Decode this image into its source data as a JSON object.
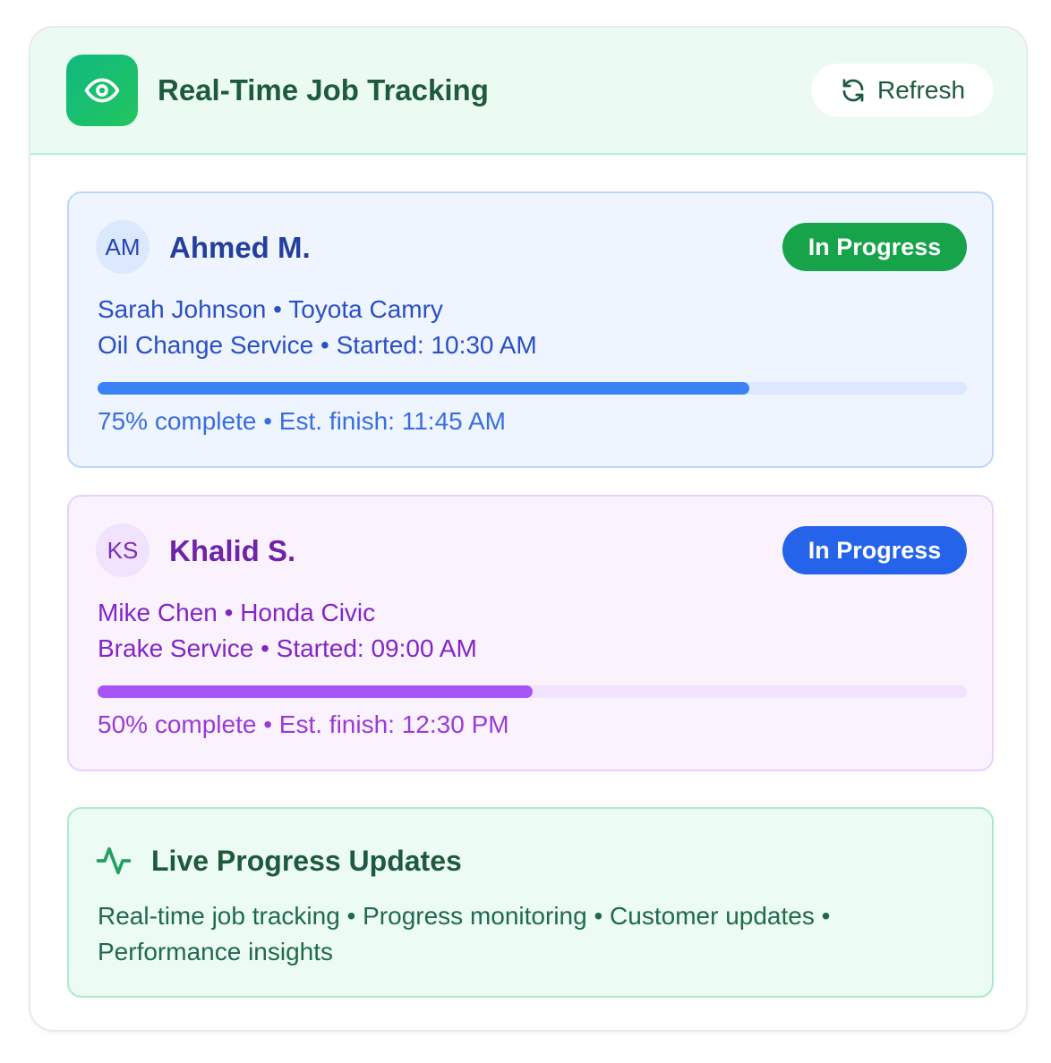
{
  "header": {
    "title": "Real-Time Job Tracking",
    "icon": "eye-icon",
    "refresh_label": "Refresh",
    "refresh_icon": "refresh-icon"
  },
  "jobs": [
    {
      "initials": "AM",
      "technician": "Ahmed M.",
      "status": "In Progress",
      "status_color": "#16a34a",
      "customer_vehicle": "Sarah Johnson • Toyota Camry",
      "service_started": "Oil Change Service • Started: 10:30 AM",
      "progress_percent": 75,
      "progress_text": "75% complete • Est. finish: 11:45 AM",
      "accent": "#3b82f6"
    },
    {
      "initials": "KS",
      "technician": "Khalid S.",
      "status": "In Progress",
      "status_color": "#2563eb",
      "customer_vehicle": "Mike Chen • Honda Civic",
      "service_started": "Brake Service • Started: 09:00 AM",
      "progress_percent": 50,
      "progress_text": "50% complete • Est. finish: 12:30 PM",
      "accent": "#a855f7"
    }
  ],
  "live_updates": {
    "icon": "activity-icon",
    "title": "Live Progress Updates",
    "description": "Real-time job tracking • Progress monitoring • Customer updates • Performance insights"
  }
}
